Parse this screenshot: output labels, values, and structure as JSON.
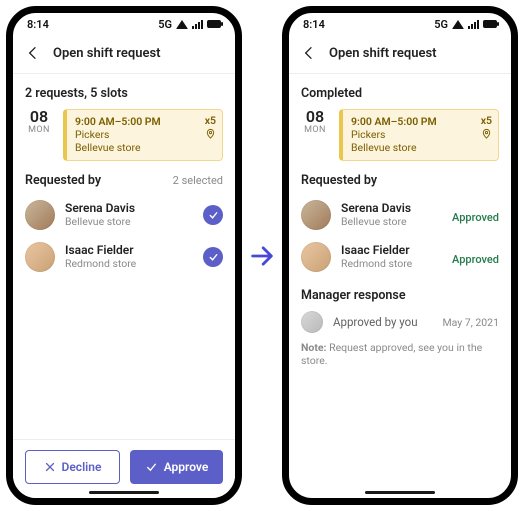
{
  "status": {
    "time": "8:14",
    "network": "5G"
  },
  "appbar": {
    "title": "Open shift request"
  },
  "left": {
    "summary": "2 requests, 5 slots",
    "date_day": "08",
    "date_dow": "MON",
    "shift": {
      "time": "9:00 AM–5:00 PM",
      "role": "Pickers",
      "store": "Bellevue store",
      "slots": "x5"
    },
    "requested_by_title": "Requested by",
    "selected_text": "2 selected",
    "people": [
      {
        "name": "Serena Davis",
        "sub": "Bellevue store"
      },
      {
        "name": "Isaac Fielder",
        "sub": "Redmond store"
      }
    ],
    "decline_label": "Decline",
    "approve_label": "Approve"
  },
  "right": {
    "summary": "Completed",
    "date_day": "08",
    "date_dow": "MON",
    "shift": {
      "time": "9:00 AM–5:00 PM",
      "role": "Pickers",
      "store": "Bellevue store",
      "slots": "x5"
    },
    "requested_by_title": "Requested by",
    "approved_label": "Approved",
    "people": [
      {
        "name": "Serena Davis",
        "sub": "Bellevue store"
      },
      {
        "name": "Isaac Fielder",
        "sub": "Redmond store"
      }
    ],
    "manager_title": "Manager response",
    "manager_text": "Approved by you",
    "manager_date": "May 7, 2021",
    "note_label": "Note:",
    "note_text": " Request approved, see you in the store."
  }
}
